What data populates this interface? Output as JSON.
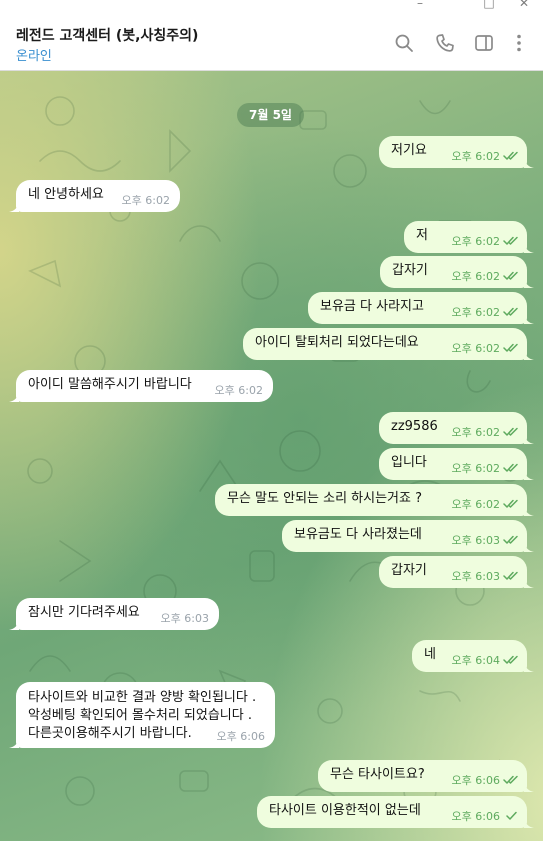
{
  "window": {
    "minimize_label": "–",
    "maximize_label": "□",
    "close_label": "✕"
  },
  "header": {
    "title": "레전드 고객센터 (봇,사칭주의)",
    "status": "온라인",
    "icons": [
      "search-icon",
      "phone-icon",
      "sidebar-toggle-icon",
      "more-vertical-icon"
    ]
  },
  "chat": {
    "date": "7월 5일",
    "colors": {
      "outgoing_bubble": "#effdde",
      "incoming_bubble": "#ffffff",
      "read_tick": "#5eaa5e",
      "status_text": "#3a8fd0"
    },
    "messages": [
      {
        "dir": "out",
        "text": "저기요",
        "time": "오후 6:02",
        "read": true
      },
      {
        "dir": "in",
        "text": "네 안녕하세요",
        "time": "오후 6:02"
      },
      {
        "dir": "out",
        "text": "저",
        "time": "오후 6:02",
        "read": true
      },
      {
        "dir": "out",
        "text": "갑자기",
        "time": "오후 6:02",
        "read": true
      },
      {
        "dir": "out",
        "text": "보유금 다 사라지고",
        "time": "오후 6:02",
        "read": true
      },
      {
        "dir": "out",
        "text": "아이디 탈퇴처리 되었다는데요",
        "time": "오후 6:02",
        "read": true
      },
      {
        "dir": "in",
        "text": "아이디 말씀해주시기 바랍니다",
        "time": "오후 6:02"
      },
      {
        "dir": "out",
        "text": "zz9586",
        "time": "오후 6:02",
        "read": true
      },
      {
        "dir": "out",
        "text": "입니다",
        "time": "오후 6:02",
        "read": true
      },
      {
        "dir": "out",
        "text": "무슨 말도 안되는 소리 하시는거죠 ?",
        "time": "오후 6:02",
        "read": true
      },
      {
        "dir": "out",
        "text": "보유금도 다 사라졌는데",
        "time": "오후 6:03",
        "read": true
      },
      {
        "dir": "out",
        "text": "갑자기",
        "time": "오후 6:03",
        "read": true
      },
      {
        "dir": "in",
        "text": "잠시만 기다려주세요",
        "time": "오후 6:03"
      },
      {
        "dir": "out",
        "text": "네",
        "time": "오후 6:04",
        "read": true
      },
      {
        "dir": "in",
        "text": "타사이트와 비교한 결과 양방 확인됩니다 .\n악성베팅 확인되어 몰수처리 되었습니다 .\n다른곳이용해주시기 바랍니다.",
        "time": "오후 6:06"
      },
      {
        "dir": "out",
        "text": "무슨 타사이트요?",
        "time": "오후 6:06",
        "read": true
      },
      {
        "dir": "out",
        "text": "타사이트 이용한적이 없는데",
        "time": "오후 6:06",
        "read": false
      }
    ]
  }
}
